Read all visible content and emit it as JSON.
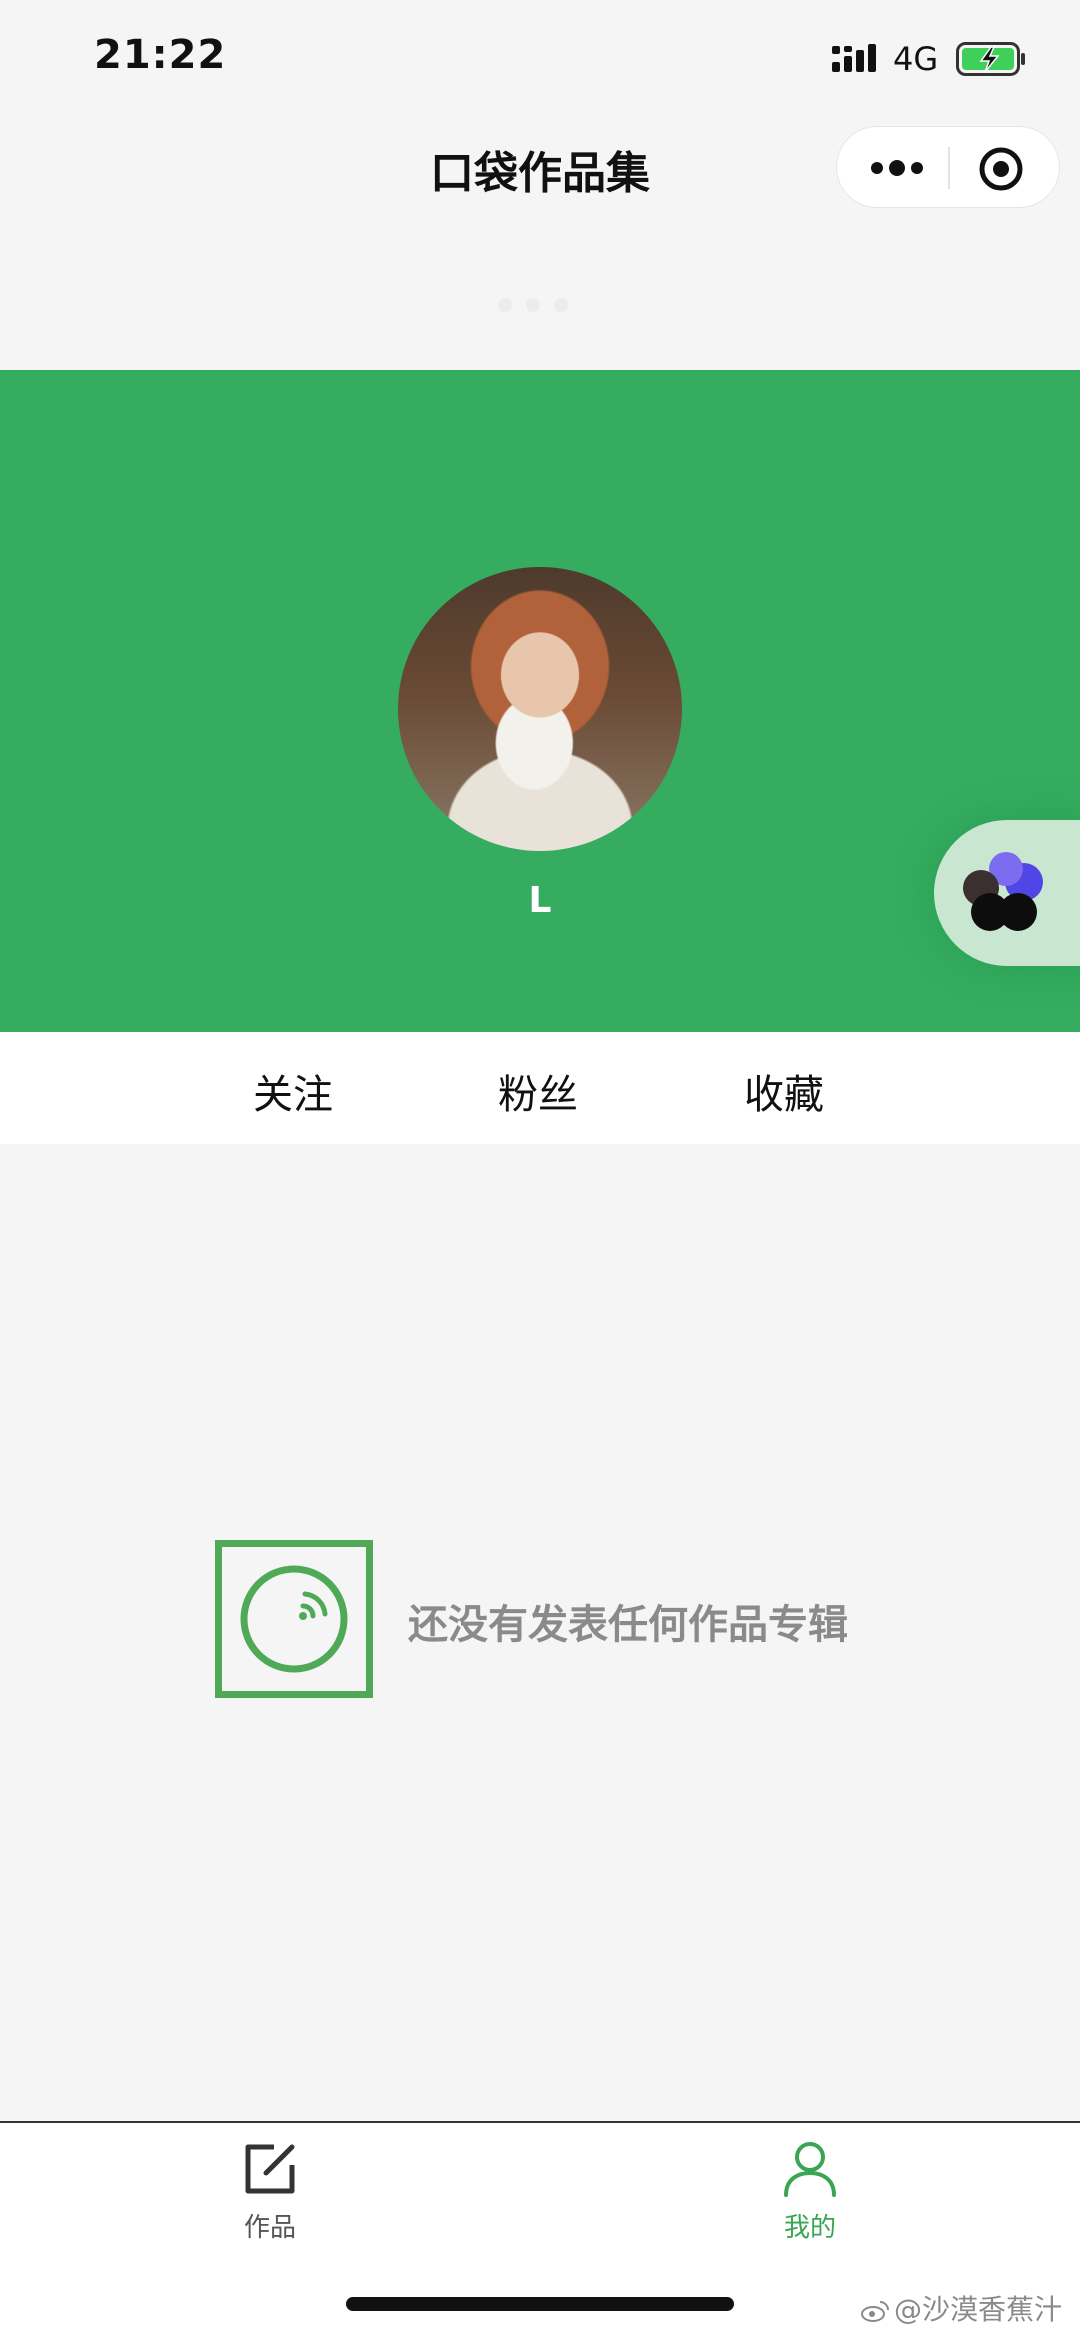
{
  "status_bar": {
    "time": "21:22",
    "network": "4G"
  },
  "nav": {
    "title": "口袋作品集"
  },
  "profile": {
    "username": "L"
  },
  "stats": {
    "follow": "关注",
    "fans": "粉丝",
    "favorites": "收藏"
  },
  "empty_state": {
    "message": "还没有发表任何作品专辑"
  },
  "tab_bar": {
    "works_label": "作品",
    "mine_label": "我的",
    "active_tab": "我的"
  },
  "watermark": {
    "text": "@沙漠香蕉汁"
  },
  "colors": {
    "brand_green": "#36ac61",
    "empty_icon_green": "#4fa956",
    "active_tab_green": "#3aa553"
  }
}
